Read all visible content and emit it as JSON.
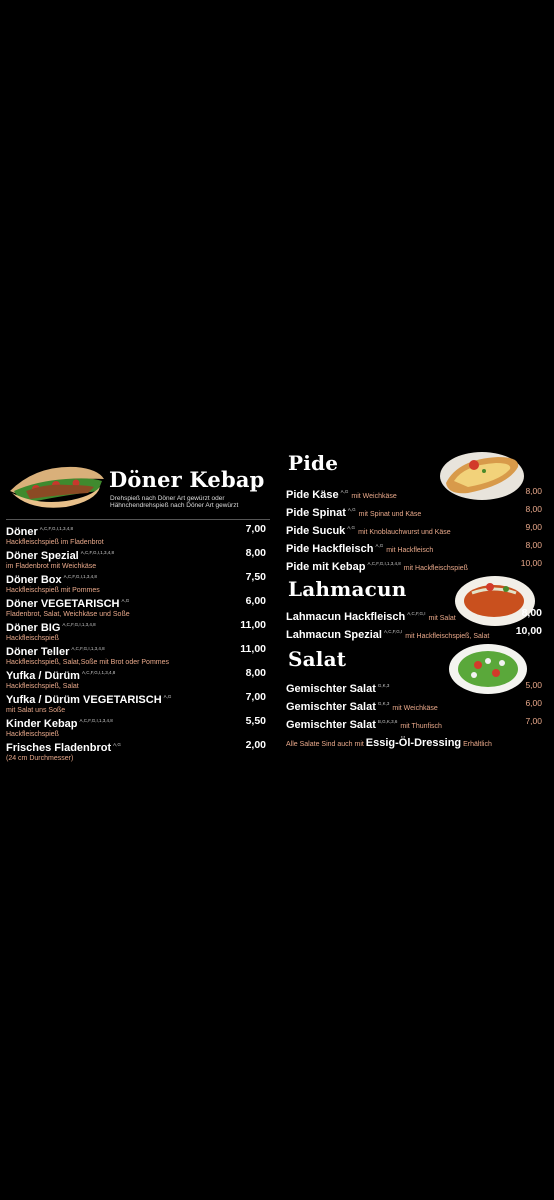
{
  "doner": {
    "title": "Döner Kebap",
    "subtitle1": "Drehspieß nach Döner Art gewürzt oder",
    "subtitle2": "Hähnchendrehspieß nach Döner Art gewürzt",
    "items": [
      {
        "name": "Döner",
        "sup": "A,C,F,G,I,1,3,4,8",
        "price": "7,00",
        "desc": "Hackfleischspieß im Fladenbrot"
      },
      {
        "name": "Döner Spezial",
        "sup": "A,C,F,G,I,1,3,4,8",
        "price": "8,00",
        "desc": "im Fladenbrot mit Weichkäse"
      },
      {
        "name": "Döner Box",
        "sup": "A,C,F,G,I,1,3,4,8",
        "price": "7,50",
        "desc": "Hackfleischspieß mit Pommes"
      },
      {
        "name": "Döner VEGETARISCH",
        "sup": "A,G",
        "price": "6,00",
        "desc": "Fladenbrot, Salat, Weichkäse und Soße"
      },
      {
        "name": "Döner BIG",
        "sup": "A,C,F,G,I,1,3,4,8",
        "price": "11,00",
        "desc": "Hackfleischspieß"
      },
      {
        "name": "Döner Teller",
        "sup": "A,C,F,G,I,1,3,4,8",
        "price": "11,00",
        "desc": "Hackfleischspieß, Salat,Soße mit Brot oder Pommes"
      },
      {
        "name": "Yufka / Dürüm",
        "sup": "A,C,F,G,I,1,3,4,8",
        "price": "8,00",
        "desc": "Hackfleischspieß, Salat"
      },
      {
        "name": "Yufka / Dürüm VEGETARISCH",
        "sup": "A,G",
        "price": "7,00",
        "desc": "mit Salat uns Soße"
      },
      {
        "name": "Kinder Kebap",
        "sup": "A,C,F,G,I,1,3,4,8",
        "price": "5,50",
        "desc": "Hackfleischspieß"
      },
      {
        "name": "Frisches Fladenbrot",
        "sup": "A,G",
        "price": "2,00",
        "desc": "(24 cm Durchmesser)"
      }
    ]
  },
  "pide": {
    "title": "Pide",
    "items": [
      {
        "name": "Pide Käse",
        "sup": "A,G",
        "desc": "mit Weichkäse",
        "price": "8,00"
      },
      {
        "name": "Pide Spinat",
        "sup": "A,G",
        "desc": "mit Spinat und Käse",
        "price": "8,00"
      },
      {
        "name": "Pide Sucuk",
        "sup": "A,G",
        "desc": "mit Knoblauchwurst und Käse",
        "price": "9,00"
      },
      {
        "name": "Pide Hackfleisch",
        "sup": "A,G",
        "desc": "mit Hackfleisch",
        "price": "8,00"
      },
      {
        "name": "Pide mit Kebap",
        "sup": "A,C,F,G,I,1,3,4,8",
        "desc": "mit Hackfleischspieß",
        "price": "10,00"
      }
    ]
  },
  "lahmacun": {
    "title": "Lahmacun",
    "items": [
      {
        "name": "Lahmacun Hackfleisch",
        "sup": "A,C,F,G,I",
        "desc": "mit Salat",
        "price": "8,00"
      },
      {
        "name": "Lahmacun Spezial",
        "sup": "A,C,F,G,I",
        "desc": "mit Hackfleischspieß, Salat",
        "price": "10,00"
      }
    ]
  },
  "salat": {
    "title": "Salat",
    "items": [
      {
        "name": "Gemischter Salat",
        "sup": "G,K,3",
        "desc": "",
        "price": "5,00"
      },
      {
        "name": "Gemischter Salat",
        "sup": "G,K,3",
        "desc": "mit Weichkäse",
        "price": "6,00"
      },
      {
        "name": "Gemischter Salat",
        "sup": "B,G,K,3,6",
        "desc": "mit Thunfisch",
        "price": "7,00"
      }
    ],
    "note_pre": "Alle Salate Sind auch mit",
    "note_bold": "Essig-Öl-Dressing",
    "note_post": "Erhältlich"
  }
}
